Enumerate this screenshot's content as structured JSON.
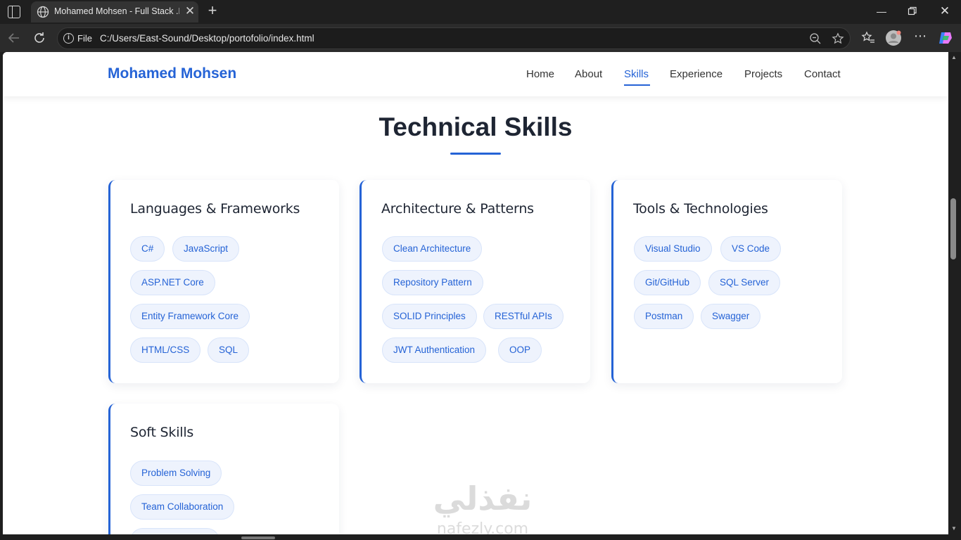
{
  "browser": {
    "tab_title": "Mohamed Mohsen - Full Stack .NET",
    "address_scheme": "File",
    "address_url": "C:/Users/East-Sound/Desktop/portofolio/index.html"
  },
  "site": {
    "brand": "Mohamed Mohsen",
    "nav": [
      "Home",
      "About",
      "Skills",
      "Experience",
      "Projects",
      "Contact"
    ],
    "active_nav": "Skills",
    "accent_color": "#2563d6"
  },
  "skills": {
    "title": "Technical Skills",
    "cards": [
      {
        "title": "Languages & Frameworks",
        "items": [
          "C#",
          "JavaScript",
          "ASP.NET Core",
          "Entity Framework Core",
          "HTML/CSS",
          "SQL"
        ]
      },
      {
        "title": "Architecture & Patterns",
        "items": [
          "Clean Architecture",
          "Repository Pattern",
          "SOLID Principles",
          "RESTful APIs",
          "JWT Authentication",
          "OOP"
        ]
      },
      {
        "title": "Tools & Technologies",
        "items": [
          "Visual Studio",
          "VS Code",
          "Git/GitHub",
          "SQL Server",
          "Postman",
          "Swagger"
        ]
      },
      {
        "title": "Soft Skills",
        "items": [
          "Problem Solving",
          "Team Collaboration"
        ]
      }
    ]
  },
  "watermark": {
    "arabic": "نفذلي",
    "latin": "nafezly.com"
  }
}
